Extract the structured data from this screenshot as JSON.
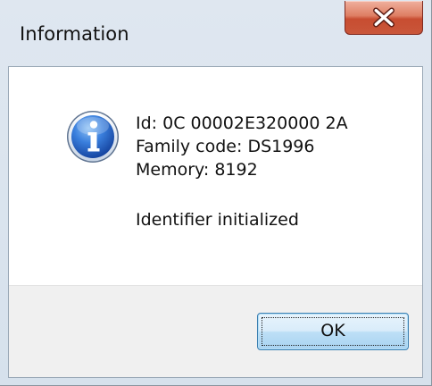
{
  "window": {
    "title": "Information"
  },
  "titlebar": {
    "close_icon": "close-x-icon",
    "close_color": "#c9563a"
  },
  "message": {
    "icon": "info-icon",
    "lines": [
      "Id: 0C 00002E320000 2A",
      "Family code: DS1996",
      "Memory: 8192"
    ],
    "status": "Identifier initialized"
  },
  "buttons": {
    "ok_label": "OK"
  },
  "colors": {
    "info_icon_blue": "#2a64c5",
    "ok_border": "#3c7fb1",
    "footer_bg": "#f0f0f0"
  }
}
